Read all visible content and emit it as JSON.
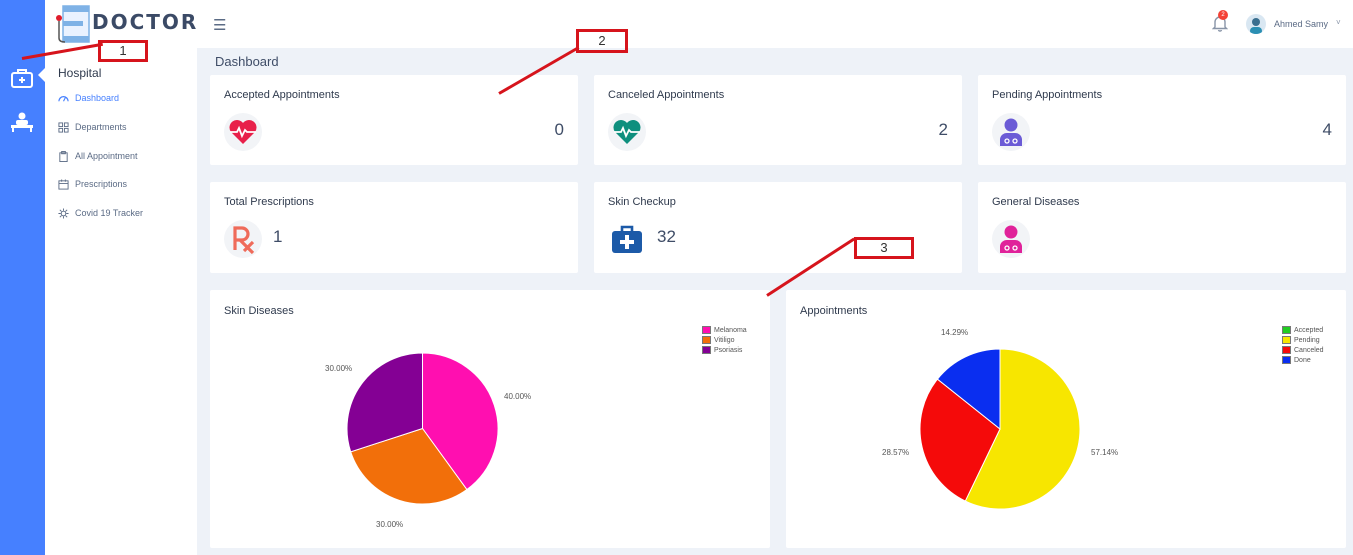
{
  "brand": {
    "logo_text": "DOCTOR"
  },
  "sidebar": {
    "section_title": "Hospital",
    "items": [
      {
        "label": "Dashboard",
        "icon": "gauge-icon",
        "active": true
      },
      {
        "label": "Departments",
        "icon": "grid-icon",
        "active": false
      },
      {
        "label": "All Appointment",
        "icon": "clipboard-icon",
        "active": false
      },
      {
        "label": "Prescriptions",
        "icon": "calendar-icon",
        "active": false
      },
      {
        "label": "Covid 19 Tracker",
        "icon": "virus-icon",
        "active": false
      }
    ]
  },
  "header": {
    "notification_count": "2",
    "user_name": "Ahmed Samy",
    "user_chevron": "˅"
  },
  "page": {
    "title": "Dashboard"
  },
  "cards": [
    {
      "title": "Accepted Appointments",
      "value": "0",
      "icon": "heart-pulse-icon",
      "color": "#e8204a"
    },
    {
      "title": "Canceled Appointments",
      "value": "2",
      "icon": "heart-pulse-icon",
      "color": "#0e8f7e"
    },
    {
      "title": "Pending Appointments",
      "value": "4",
      "icon": "doctor-icon",
      "color": "#6b5bd6"
    },
    {
      "title": "Total Prescriptions",
      "value": "1",
      "icon": "rx-icon",
      "color": "#ef6b5a"
    },
    {
      "title": "Skin Checkup",
      "value": "32",
      "icon": "medical-kit-icon",
      "color": "#1c5aa8"
    },
    {
      "title": "General Diseases",
      "value": "",
      "icon": "doctor-icon",
      "color": "#e0229a"
    }
  ],
  "chart_data": [
    {
      "type": "pie",
      "title": "Skin Diseases",
      "categories": [
        "Melanoma",
        "Vitiligo",
        "Psoriasis"
      ],
      "values": [
        40.0,
        30.0,
        30.0
      ],
      "labels": [
        "40.00%",
        "30.00%",
        "30.00%"
      ],
      "colors": [
        "#ff0fb0",
        "#f26f0a",
        "#840094"
      ],
      "legend": "top-right"
    },
    {
      "type": "pie",
      "title": "Appointments",
      "categories": [
        "Accepted",
        "Pending",
        "Canceled",
        "Done"
      ],
      "values": [
        0,
        57.14,
        28.57,
        14.29
      ],
      "labels": [
        "",
        "57.14%",
        "28.57%",
        "14.29%"
      ],
      "colors": [
        "#22cc22",
        "#f7e600",
        "#f50a0a",
        "#0a2ef0"
      ],
      "legend": "top-right"
    }
  ],
  "annotations": [
    "1",
    "2",
    "3"
  ],
  "colors": {
    "accent": "#4680ff",
    "annotation": "#d6141c"
  }
}
